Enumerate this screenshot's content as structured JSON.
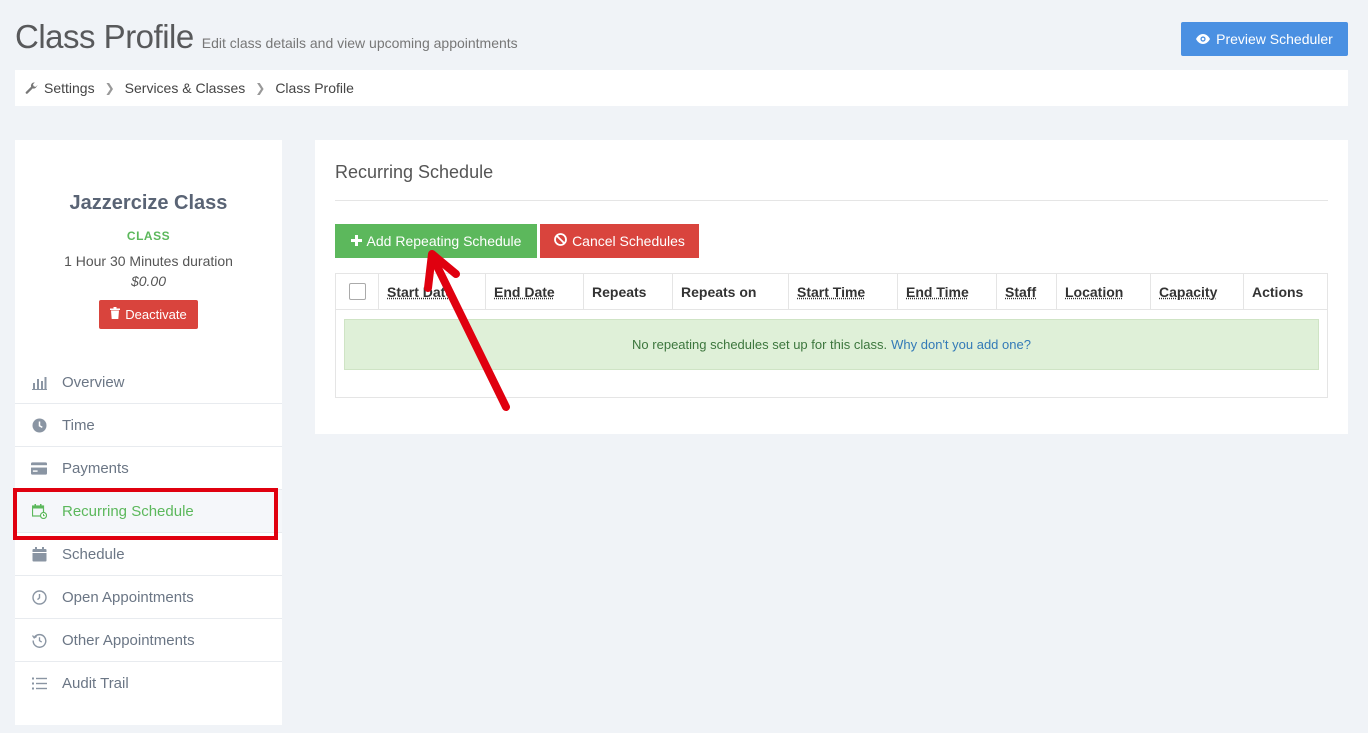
{
  "header": {
    "title": "Class Profile",
    "subtitle": "Edit class details and view upcoming appointments",
    "preview_button": "Preview Scheduler"
  },
  "breadcrumb": [
    "Settings",
    "Services & Classes",
    "Class Profile"
  ],
  "profile": {
    "name": "Jazzercize Class",
    "type": "CLASS",
    "duration": "1 Hour 30 Minutes duration",
    "price": "$0.00",
    "deactivate_label": "Deactivate"
  },
  "nav": {
    "items": [
      {
        "label": "Overview",
        "icon": "chart-icon",
        "active": false
      },
      {
        "label": "Time",
        "icon": "clock-icon",
        "active": false
      },
      {
        "label": "Payments",
        "icon": "credit-card-icon",
        "active": false
      },
      {
        "label": "Recurring Schedule",
        "icon": "calendar-repeat-icon",
        "active": true
      },
      {
        "label": "Schedule",
        "icon": "calendar-icon",
        "active": false
      },
      {
        "label": "Open Appointments",
        "icon": "clock-open-icon",
        "active": false
      },
      {
        "label": "Other Appointments",
        "icon": "history-icon",
        "active": false
      },
      {
        "label": "Audit Trail",
        "icon": "list-icon",
        "active": false
      }
    ]
  },
  "main": {
    "title": "Recurring Schedule",
    "add_button": "Add Repeating Schedule",
    "cancel_button": "Cancel Schedules",
    "columns": [
      "Start Date",
      "End Date",
      "Repeats",
      "Repeats on",
      "Start Time",
      "End Time",
      "Staff",
      "Location",
      "Capacity",
      "Actions"
    ],
    "empty_message": "No repeating schedules set up for this class.",
    "empty_link": "Why don't you add one?"
  },
  "colors": {
    "primary_blue": "#4a90e2",
    "success_green": "#5cb85c",
    "danger_red": "#d9443d",
    "annotation_red": "#e0000f"
  }
}
